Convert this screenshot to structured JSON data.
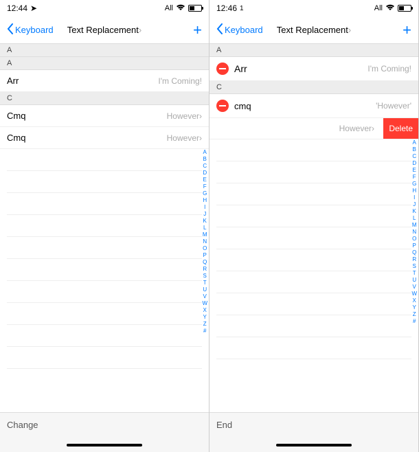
{
  "left": {
    "status": {
      "time": "12:44",
      "carrier": "All"
    },
    "nav": {
      "back": "Keyboard",
      "title": "Text Replacement",
      "title_decor": "›"
    },
    "sections": {
      "A": {
        "header": "A"
      },
      "C": {
        "header": "C"
      }
    },
    "rows": {
      "a1": {
        "shortcut": "Arr",
        "phrase": "I'm Coming!"
      },
      "c1": {
        "shortcut": "Cmq",
        "phrase": "However›"
      },
      "c2": {
        "shortcut": "Cmq",
        "phrase": "However›"
      }
    },
    "section_hint": "A",
    "footer": "Change"
  },
  "right": {
    "status": {
      "time": "12:46",
      "carrier": "All"
    },
    "nav": {
      "back": "Keyboard",
      "title": "Text Replacement",
      "title_decor": "›"
    },
    "sections": {
      "A": {
        "header": "A"
      },
      "C": {
        "header": "C"
      }
    },
    "rows": {
      "a1": {
        "shortcut": "Arr",
        "phrase": "I'm Coming!"
      },
      "c1": {
        "shortcut": "cmq",
        "phrase": "'However'"
      },
      "c2": {
        "shortcut": "",
        "phrase": "However›",
        "delete_label": "Delete"
      }
    },
    "footer": "End"
  },
  "index_letters": [
    "A",
    "B",
    "C",
    "D",
    "E",
    "F",
    "G",
    "H",
    "I",
    "J",
    "K",
    "L",
    "M",
    "N",
    "O",
    "P",
    "Q",
    "R",
    "S",
    "T",
    "U",
    "V",
    "W",
    "X",
    "Y",
    "Z",
    "#"
  ]
}
